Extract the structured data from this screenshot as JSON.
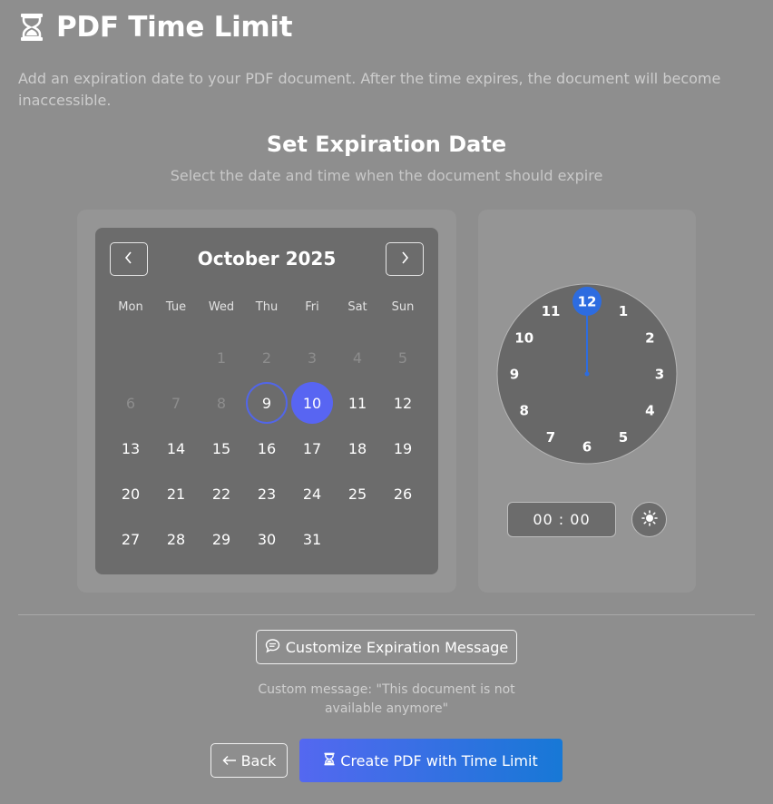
{
  "header": {
    "title": "PDF Time Limit",
    "icon": "hourglass-icon"
  },
  "description": "Add an expiration date to your PDF document. After the time expires, the document will become inaccessible.",
  "section": {
    "title": "Set Expiration Date",
    "subtitle": "Select the date and time when the document should expire"
  },
  "calendar": {
    "month_label": "October 2025",
    "weekdays": [
      "Mon",
      "Tue",
      "Wed",
      "Thu",
      "Fri",
      "Sat",
      "Sun"
    ],
    "days": [
      "1",
      "2",
      "3",
      "4",
      "5",
      "6",
      "7",
      "8",
      "9",
      "10",
      "11",
      "12",
      "13",
      "14",
      "15",
      "16",
      "17",
      "18",
      "19",
      "20",
      "21",
      "22",
      "23",
      "24",
      "25",
      "26",
      "27",
      "28",
      "29",
      "30",
      "31"
    ],
    "first_weekday_index": 2,
    "disabled_until": 8,
    "today": 9,
    "selected": 10
  },
  "clock": {
    "numbers": [
      "12",
      "1",
      "2",
      "3",
      "4",
      "5",
      "6",
      "7",
      "8",
      "9",
      "10",
      "11"
    ],
    "selected_hour": "12",
    "time_value": "00 : 00"
  },
  "actions": {
    "customize_label": "Customize Expiration Message",
    "custom_message": "Custom message: \"This document is not available anymore\"",
    "back_label": "Back",
    "create_label": "Create PDF with Time Limit"
  },
  "colors": {
    "accent": "#5865f2",
    "today_ring": "#5266e8",
    "clock_accent": "#2d6ce0",
    "create_gradient_start": "#5468f0",
    "create_gradient_end": "#1778d6"
  }
}
